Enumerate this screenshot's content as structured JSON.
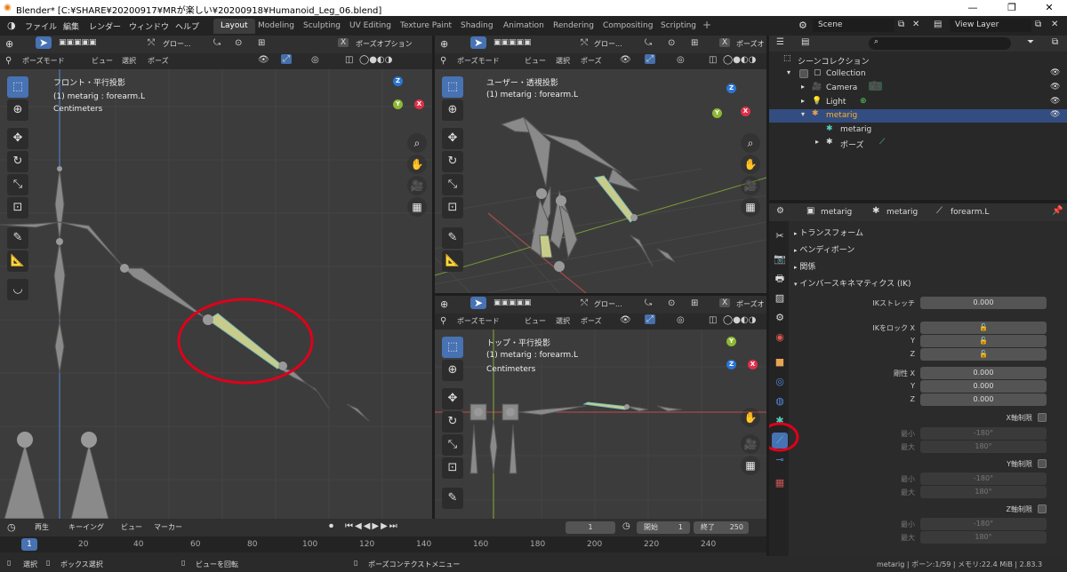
{
  "title_bar": {
    "title": "Blender* [C:¥SHARE¥20200917¥MRが楽しい¥20200918¥Humanoid_Leg_06.blend]"
  },
  "menus": [
    "ファイル",
    "編集",
    "レンダー",
    "ウィンドウ",
    "ヘルプ"
  ],
  "workspace_tabs": [
    "Layout",
    "Modeling",
    "Sculpting",
    "UV Editing",
    "Texture Paint",
    "Shading",
    "Animation",
    "Rendering",
    "Compositing",
    "Scripting"
  ],
  "active_tab": "Layout",
  "scene": "Scene",
  "view_layer": "View Layer",
  "viewport_header": {
    "transform": "グロー...",
    "pose_options": "ポーズオプション",
    "mode": "ポーズモード",
    "view": "ビュー",
    "select": "選択",
    "pose": "ポーズ"
  },
  "viewport_front": {
    "line1": "フロント・平行投影",
    "line2": "(1) metarig : forearm.L",
    "line3": "Centimeters"
  },
  "viewport_user": {
    "line1": "ユーザー・透視投影",
    "line2": "(1) metarig : forearm.L"
  },
  "viewport_top": {
    "line1": "トップ・平行投影",
    "line2": "(1) metarig : forearm.L",
    "line3": "Centimeters",
    "pose_options": "ポーズオ"
  },
  "axes": {
    "x": "X",
    "y": "Y",
    "z": "Z"
  },
  "outliner": {
    "root": "シーンコレクション",
    "collection": "Collection",
    "items": [
      "Camera",
      "Light",
      "metarig"
    ],
    "armature_data": "metarig",
    "pose": "ポーズ"
  },
  "props_header": {
    "object": "metarig",
    "armature": "metarig",
    "bone": "forearm.L"
  },
  "sections": {
    "transform": "トランスフォーム",
    "bendy": "ベンディボーン",
    "relations": "関係",
    "ik": "インバースキネマティクス (IK)"
  },
  "ik": {
    "stretch_label": "IKストレッチ",
    "stretch_value": "0.000",
    "lock_label": "IKをロック X",
    "y": "Y",
    "z": "Z",
    "stiff_label": "剛性 X",
    "stiff_x": "0.000",
    "stiff_y": "0.000",
    "stiff_z": "0.000",
    "xlimit": "X軸制限",
    "ylimit": "Y軸制限",
    "zlimit": "Z軸制限",
    "min": "最小",
    "max": "最大",
    "min_val": "-180°",
    "max_val": "180°"
  },
  "timeline": {
    "playback": "再生",
    "keying": "キーイング",
    "view": "ビュー",
    "marker": "マーカー",
    "current_frame": "1",
    "start_label": "開始",
    "start": "1",
    "end_label": "終了",
    "end": "250",
    "ticks": [
      "1",
      "20",
      "40",
      "60",
      "80",
      "100",
      "120",
      "140",
      "160",
      "180",
      "200",
      "220",
      "240"
    ]
  },
  "statusbar": {
    "select": "選択",
    "box_select": "ボックス選択",
    "rotate_view": "ビューを回転",
    "context_menu": "ポーズコンテクストメニュー",
    "stats": "metarig | ボーン:1/59 | メモリ:22.4 MiB | 2.83.3"
  },
  "colors": {
    "accent": "#4772b3",
    "selected_bone": "#c8cc8a",
    "annotation": "#e0001a"
  }
}
